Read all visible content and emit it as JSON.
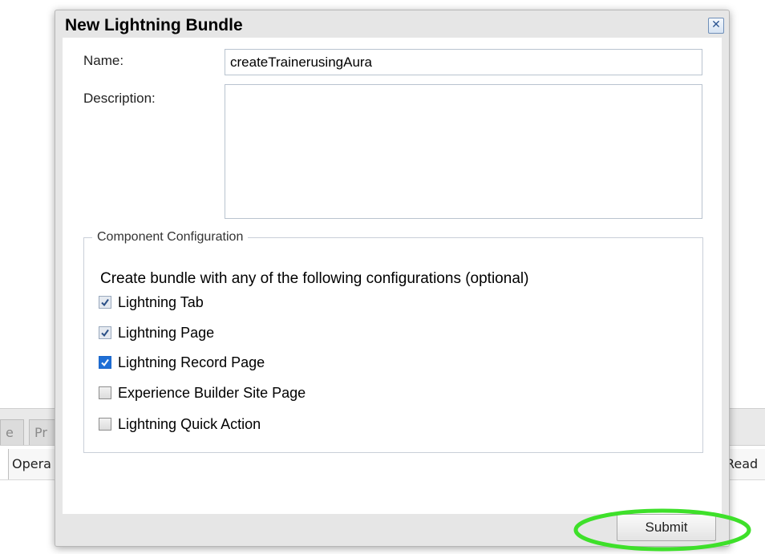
{
  "background": {
    "tabs": [
      {
        "label": "e"
      },
      {
        "label": "Pr"
      }
    ],
    "row_left": "Opera",
    "row_right": "Read"
  },
  "dialog": {
    "title": "New Lightning Bundle",
    "close_symbol": "✕",
    "name_label": "Name:",
    "name_value": "createTrainerusingAura",
    "description_label": "Description:",
    "description_value": "",
    "config": {
      "legend": "Component Configuration",
      "intro": "Create bundle with any of the following configurations (optional)",
      "options": [
        {
          "label": "Lightning Tab",
          "checked": true
        },
        {
          "label": "Lightning Page",
          "checked": true
        },
        {
          "label": "Lightning Record Page",
          "checked": true
        },
        {
          "label": "Experience Builder Site Page",
          "checked": false
        },
        {
          "label": "Lightning Quick Action",
          "checked": false
        }
      ]
    },
    "submit_label": "Submit"
  },
  "colors": {
    "highlight_ring": "#3ee02a",
    "checkbox_blue": "#1f6fd6",
    "close_blue": "#2b5592"
  },
  "icons": {
    "close": "close-icon",
    "check": "checkmark-icon"
  }
}
